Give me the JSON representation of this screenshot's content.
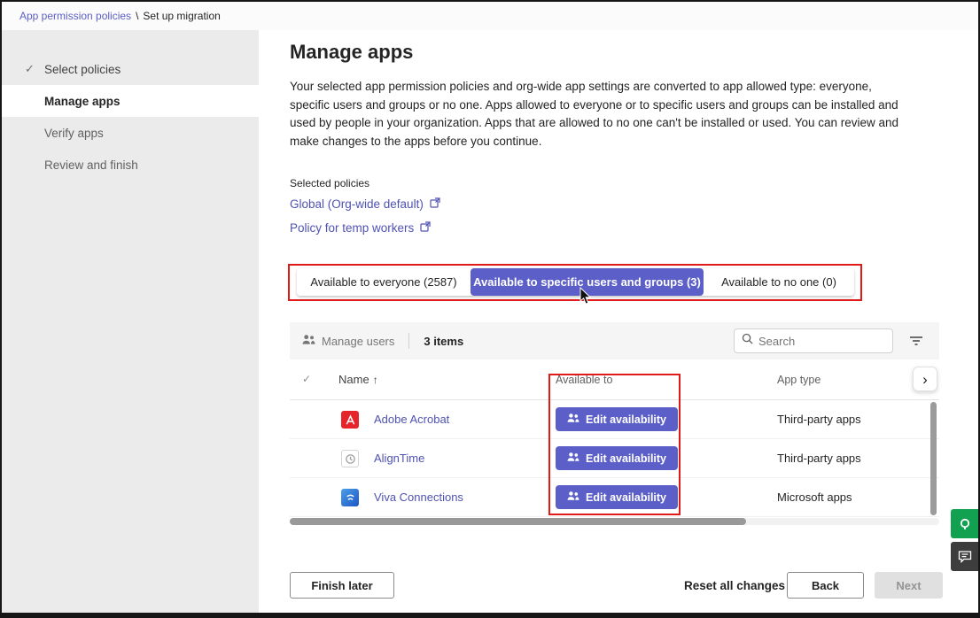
{
  "breadcrumb": {
    "link": "App permission policies",
    "separator": "\\",
    "current": "Set up migration"
  },
  "sidebar": {
    "items": [
      {
        "label": "Select policies",
        "state": "completed"
      },
      {
        "label": "Manage apps",
        "state": "active"
      },
      {
        "label": "Verify apps",
        "state": "upcoming"
      },
      {
        "label": "Review and finish",
        "state": "upcoming"
      }
    ]
  },
  "main": {
    "title": "Manage apps",
    "description": "Your selected app permission policies and org-wide app settings are converted to app allowed type: everyone, specific users and groups or no one. Apps allowed to everyone or to specific users and groups can be installed and used by people in your organization. Apps that are allowed to no one can't be installed or used. You can review and make changes to the apps before you continue.",
    "selected_policies_label": "Selected policies",
    "policies": [
      {
        "label": "Global (Org-wide default)"
      },
      {
        "label": "Policy for temp workers"
      }
    ],
    "tabs": [
      {
        "label": "Available to everyone (2587)",
        "selected": false
      },
      {
        "label": "Available to specific users and groups (3)",
        "selected": true
      },
      {
        "label": "Available to no one (0)",
        "selected": false
      }
    ]
  },
  "toolbar": {
    "manage_users_label": "Manage users",
    "items_count": "3 items",
    "search_placeholder": "Search"
  },
  "table": {
    "headers": {
      "name": "Name",
      "available_to": "Available to",
      "app_type": "App type"
    },
    "sort_arrow": "↑",
    "rows": [
      {
        "name": "Adobe Acrobat",
        "action_label": "Edit availability",
        "app_type": "Third-party apps",
        "icon": "adobe-acrobat-app-icon"
      },
      {
        "name": "AlignTime",
        "action_label": "Edit availability",
        "app_type": "Third-party apps",
        "icon": "aligntime-app-icon"
      },
      {
        "name": "Viva Connections",
        "action_label": "Edit availability",
        "app_type": "Microsoft apps",
        "icon": "viva-connections-app-icon"
      }
    ]
  },
  "footer": {
    "finish_later": "Finish later",
    "reset": "Reset all changes",
    "back": "Back",
    "next": "Next"
  },
  "glyphs": {
    "completed_check": "✓",
    "header_check": "✓",
    "chevron_right": "›"
  },
  "colors": {
    "accent": "#5b5fc7",
    "link": "#4f52b2",
    "annotation_red": "#e01919"
  }
}
